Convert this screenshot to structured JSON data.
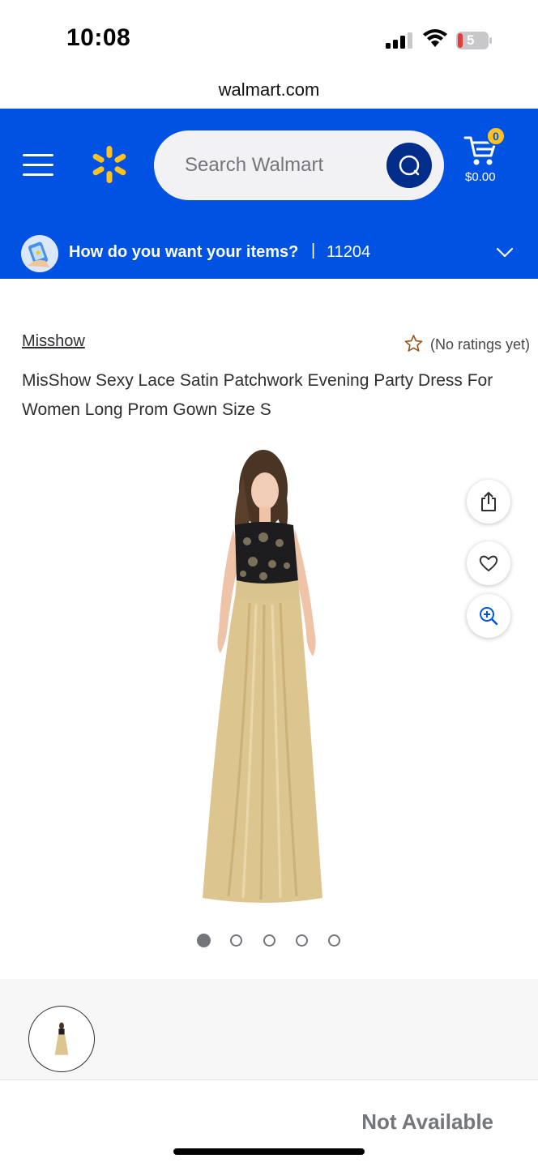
{
  "status_bar": {
    "time": "10:08",
    "battery_level": "5"
  },
  "browser": {
    "url": "walmart.com"
  },
  "header": {
    "search_placeholder": "Search Walmart",
    "cart_count": "0",
    "cart_total": "$0.00",
    "brand_color": "#0053e2",
    "spark_color": "#ffc220"
  },
  "fulfillment": {
    "prompt": "How do you want your items?",
    "separator": "|",
    "zip": "11204"
  },
  "product": {
    "brand": "Misshow",
    "rating_text": "(No ratings yet)",
    "title": "MisShow Sexy Lace Satin Patchwork Evening Party Dress For Women Long Prom Gown Size S",
    "image_count": 5,
    "active_image_index": 0
  },
  "purchase": {
    "availability": "Not Available"
  }
}
